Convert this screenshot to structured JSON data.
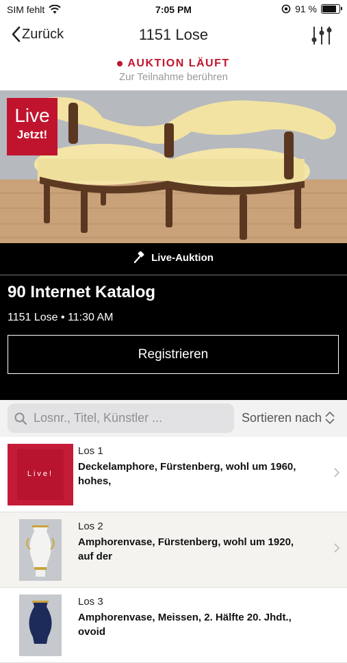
{
  "status_bar": {
    "carrier": "SIM fehlt",
    "time": "7:05 PM",
    "battery_pct": "91 %",
    "battery_level": 0.91
  },
  "nav": {
    "back_label": "Zurück",
    "title": "1151 Lose"
  },
  "live_banner": {
    "status": "AUKTION LÄUFT",
    "hint": "Zur Teilnahme berühren"
  },
  "hero": {
    "badge_line1": "Live",
    "badge_line2": "Jetzt!"
  },
  "auction": {
    "type_label": "Live-Auktion",
    "catalog_title": "90 Internet Katalog",
    "meta": "1151 Lose • 11:30 AM",
    "register_label": "Registrieren"
  },
  "search": {
    "placeholder": "Losnr., Titel, Künstler ...",
    "sort_label": "Sortieren nach"
  },
  "lots": [
    {
      "lot": "Los 1",
      "title": "Deckelamphore, Fürstenberg, wohl um 1960, hohes,",
      "thumb_text": "Live!"
    },
    {
      "lot": "Los 2",
      "title": "Amphorenvase, Fürstenberg, wohl um 1920, auf der"
    },
    {
      "lot": "Los 3",
      "title": "Amphorenvase, Meissen, 2. Hälfte 20. Jhdt., ovoid"
    }
  ],
  "colors": {
    "accent": "#c0142e",
    "banner_bg": "#000000"
  }
}
